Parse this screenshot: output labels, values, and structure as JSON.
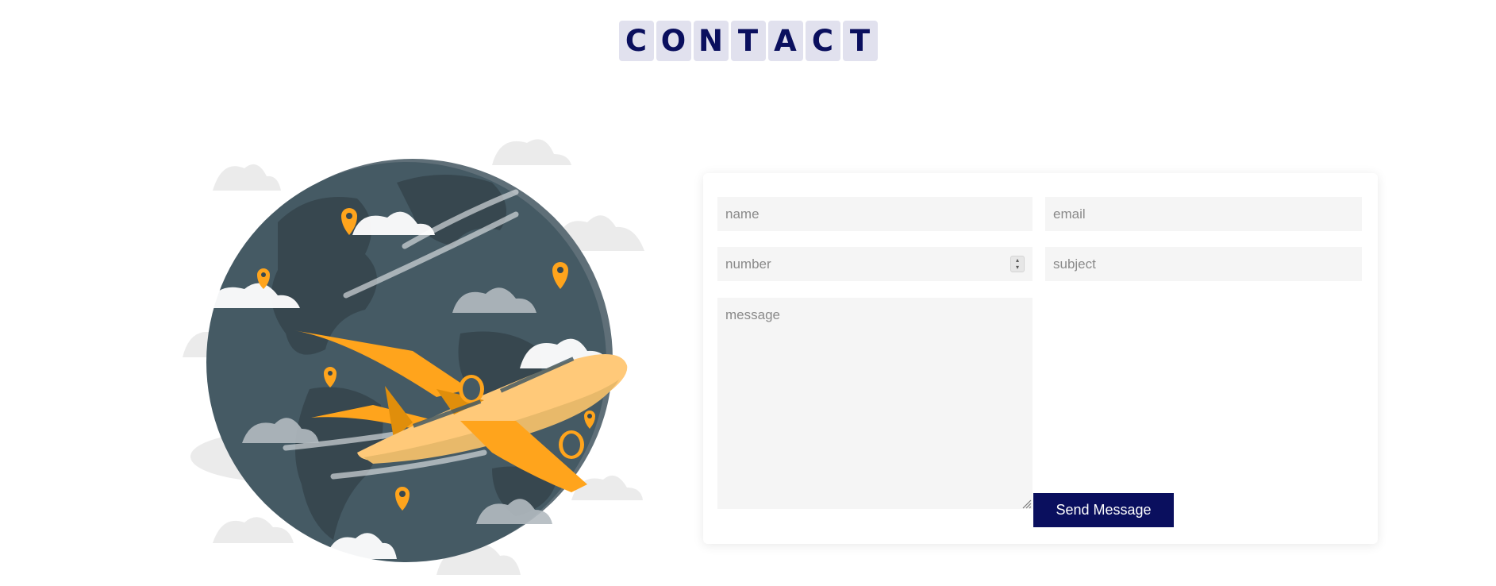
{
  "heading": {
    "letters": [
      "C",
      "O",
      "N",
      "T",
      "A",
      "C",
      "T"
    ]
  },
  "form": {
    "name_placeholder": "name",
    "email_placeholder": "email",
    "number_placeholder": "number",
    "subject_placeholder": "subject",
    "message_placeholder": "message",
    "send_label": "Send Message"
  },
  "colors": {
    "accent": "#0a0f5e",
    "tile_bg": "#e1e1ee",
    "field_bg": "#f5f5f5",
    "plane": "#ffa41c",
    "globe": "#455a64"
  },
  "illustration": {
    "icon": "globe-airplane-illustration"
  }
}
